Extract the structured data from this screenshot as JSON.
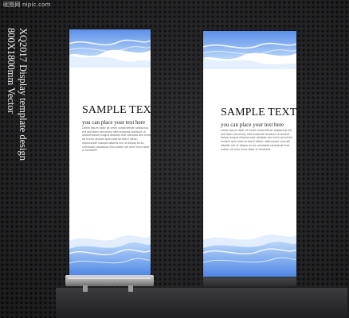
{
  "watermark": "昵图网 nipic.com",
  "side_caption": {
    "line1": "XQ2017 Display template design",
    "line2": "800X1800mm Vector"
  },
  "banners": [
    {
      "headline": "SAMPLE TEXT",
      "subline": "you can place your text here",
      "body": "Lorem ipsum dolor sit amet consectetuer adipiscing elit sed diam nonummy nibh euismod tincidunt ut laoreet dolore magna aliquam erat volutpat wisi enim ad minim veniam quis nostrud exerci tation ullamcorper suscipit lobortis nisl ut aliquip ex ea commodo consequat duis autem vel eum iriure dolor in hendrerit"
    },
    {
      "headline": "SAMPLE TEXT",
      "subline": "you can place your text here",
      "body": "Lorem ipsum dolor sit amet consectetuer adipiscing elit sed diam nonummy nibh euismod tincidunt ut laoreet dolore magna aliquam erat volutpat wisi enim ad minim veniam quis nostrud exerci tation ullamcorper suscipit lobortis nisl ut aliquip ex ea commodo consequat duis autem vel eum iriure dolor in hendrerit"
    }
  ],
  "colors": {
    "background": "#2a2a2c",
    "wave_light": "#cfe3fb",
    "wave_mid": "#8fb8f2",
    "wave_deep": "#4f86e6"
  }
}
